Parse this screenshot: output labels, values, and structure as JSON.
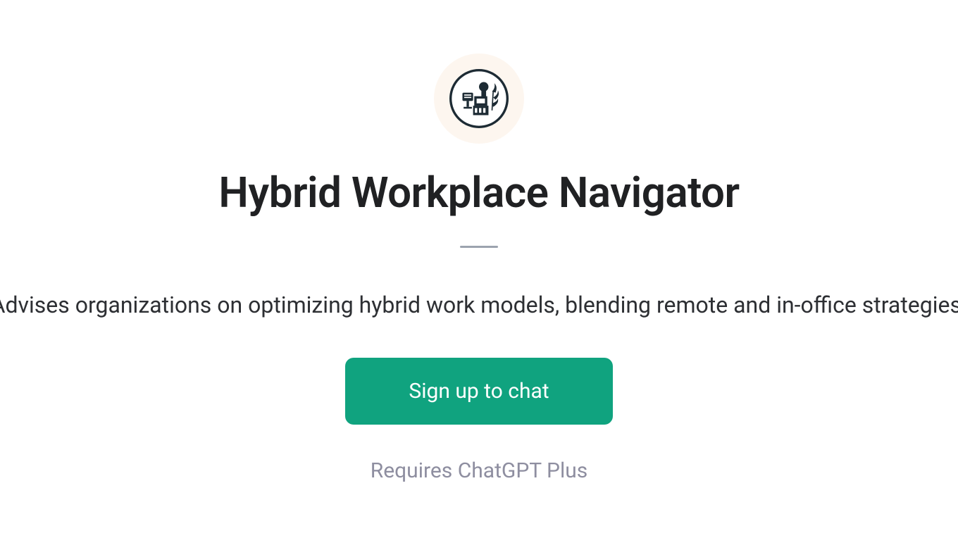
{
  "title": "Hybrid Workplace Navigator",
  "description": "Advises organizations on optimizing hybrid work models, blending remote and in-office strategies.",
  "button_label": "Sign up to chat",
  "requirement_text": "Requires ChatGPT Plus"
}
